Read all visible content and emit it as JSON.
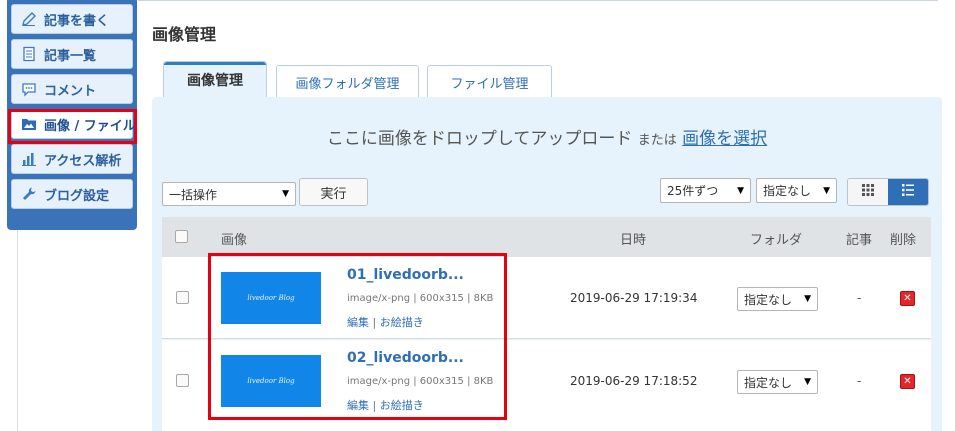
{
  "sidebar": {
    "items": [
      {
        "label": "記事を書く",
        "icon": "pencil-icon"
      },
      {
        "label": "記事一覧",
        "icon": "document-list-icon"
      },
      {
        "label": "コメント",
        "icon": "speech-bubble-icon"
      },
      {
        "label": "画像 / ファイル",
        "icon": "image-folder-icon",
        "active": true
      },
      {
        "label": "アクセス解析",
        "icon": "bar-chart-icon"
      },
      {
        "label": "ブログ設定",
        "icon": "wrench-icon"
      }
    ]
  },
  "page": {
    "title": "画像管理"
  },
  "tabs": [
    {
      "label": "画像管理",
      "active": true
    },
    {
      "label": "画像フォルダ管理"
    },
    {
      "label": "ファイル管理"
    }
  ],
  "upload": {
    "drop_text": "ここに画像をドロップしてアップロード",
    "or_text": "または",
    "select_link": "画像を選択"
  },
  "toolbar": {
    "bulk_select": "一括操作",
    "run_button": "実行",
    "per_page": "25件ずつ",
    "folder_filter": "指定なし"
  },
  "table": {
    "headers": {
      "image": "画像",
      "date": "日時",
      "folder": "フォルダ",
      "article": "記事",
      "delete": "削除"
    },
    "rows": [
      {
        "name": "01_livedoorb...",
        "meta": "image/x-png | 600x315 | 8KB",
        "edit": "編集",
        "draw": "お絵描き",
        "date": "2019-06-29 17:19:34",
        "folder": "指定なし",
        "article": "-",
        "thumb_text": "livedoor Blog"
      },
      {
        "name": "02_livedoorb...",
        "meta": "image/x-png | 600x315 | 8KB",
        "edit": "編集",
        "draw": "お絵描き",
        "date": "2019-06-29 17:18:52",
        "folder": "指定なし",
        "article": "-",
        "thumb_text": "livedoor Blog"
      }
    ]
  },
  "colors": {
    "sidebar_bg": "#3a73b8",
    "accent": "#2f6fb5",
    "highlight": "#e60012",
    "panel_bg": "#e6f3fc",
    "thumb_bg": "#1186e8",
    "delete": "#e3262a"
  }
}
